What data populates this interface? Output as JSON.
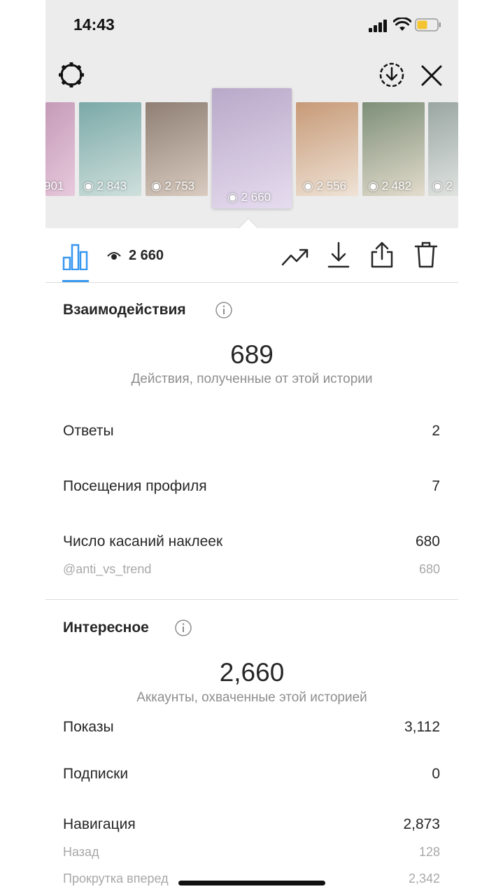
{
  "status_bar": {
    "time": "14:43"
  },
  "stories": [
    {
      "views": "901",
      "colors": [
        "#c59bb8",
        "#e7c9dc"
      ]
    },
    {
      "views": "2 843",
      "colors": [
        "#7aa9a8",
        "#cfe0dc"
      ]
    },
    {
      "views": "2 753",
      "colors": [
        "#8f7f74",
        "#d9cbbf"
      ]
    },
    {
      "views": "2 660",
      "colors": [
        "#b9a9c9",
        "#e6dcef"
      ],
      "selected": true
    },
    {
      "views": "2 556",
      "colors": [
        "#c79a77",
        "#efe3d6"
      ]
    },
    {
      "views": "2 482",
      "colors": [
        "#7d8f78",
        "#e3dccd"
      ]
    },
    {
      "views": "2",
      "colors": [
        "#9aa6a3",
        "#dfe3e0"
      ]
    }
  ],
  "toolbar": {
    "views": "2 660"
  },
  "interactions": {
    "title": "Взаимодействия",
    "total": "689",
    "total_caption": "Действия, полученные от этой истории",
    "rows": [
      {
        "label": "Ответы",
        "value": "2"
      },
      {
        "label": "Посещения профиля",
        "value": "7"
      },
      {
        "label": "Число касаний наклеек",
        "value": "680"
      }
    ],
    "sub_rows": [
      {
        "label": "@anti_vs_trend",
        "value": "680"
      }
    ]
  },
  "discovery": {
    "title": "Интересное",
    "total": "2,660",
    "total_caption": "Аккаунты, охваченные этой историей",
    "rows": [
      {
        "label": "Показы",
        "value": "3,112"
      },
      {
        "label": "Подписки",
        "value": "0"
      },
      {
        "label": "Навигация",
        "value": "2,873"
      }
    ],
    "sub_rows": [
      {
        "label": "Назад",
        "value": "128"
      },
      {
        "label": "Прокрутка вперед",
        "value": "2,342"
      }
    ]
  },
  "colors": {
    "accent": "#3897f0",
    "text": "#262626",
    "secondary": "#8e8e8e"
  }
}
